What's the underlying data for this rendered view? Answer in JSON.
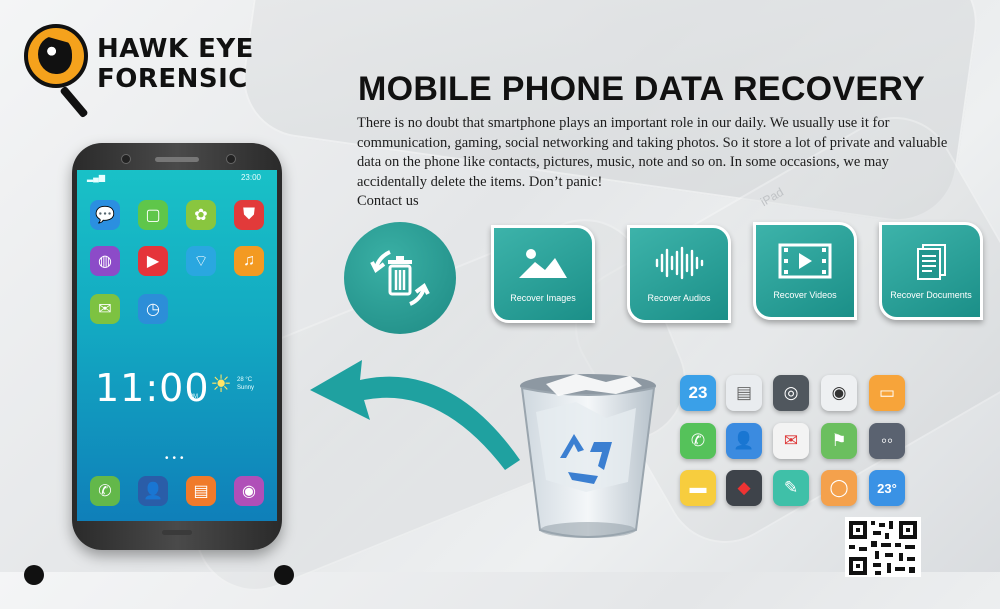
{
  "brand": {
    "line1": "HAWK EYE",
    "line2": "FORENSIC"
  },
  "heading": {
    "title": "MOBILE PHONE DATA RECOVERY",
    "description": "There is no doubt that smartphone plays an important role in our daily. We usually use it for communication, gaming, social networking and taking photos. So it store a lot of private and valuable data on the phone like contacts, pictures, music, note and so on. In some occasions, we may accidentally delete the items. Don’t panic!",
    "contact_link": "Contact us"
  },
  "phone": {
    "status_time": "23:00",
    "clock_time": "11:00",
    "clock_suffix": "PM",
    "weather_temp": "28 °C",
    "weather_cond": "Sunny",
    "page_dots": "•••"
  },
  "cards": [
    {
      "label": "Recover Images",
      "icon": "image-icon"
    },
    {
      "label": "Recover Audios",
      "icon": "audio-wave-icon"
    },
    {
      "label": "Recover Videos",
      "icon": "video-icon"
    },
    {
      "label": "Recover Documents",
      "icon": "document-icon"
    }
  ],
  "icon_grid": {
    "calendar_day": "23",
    "weather_temp": "23°"
  },
  "colors": {
    "teal": "#1e8a84",
    "teal_light": "#3db3aa",
    "logo_orange": "#f5a21c"
  }
}
